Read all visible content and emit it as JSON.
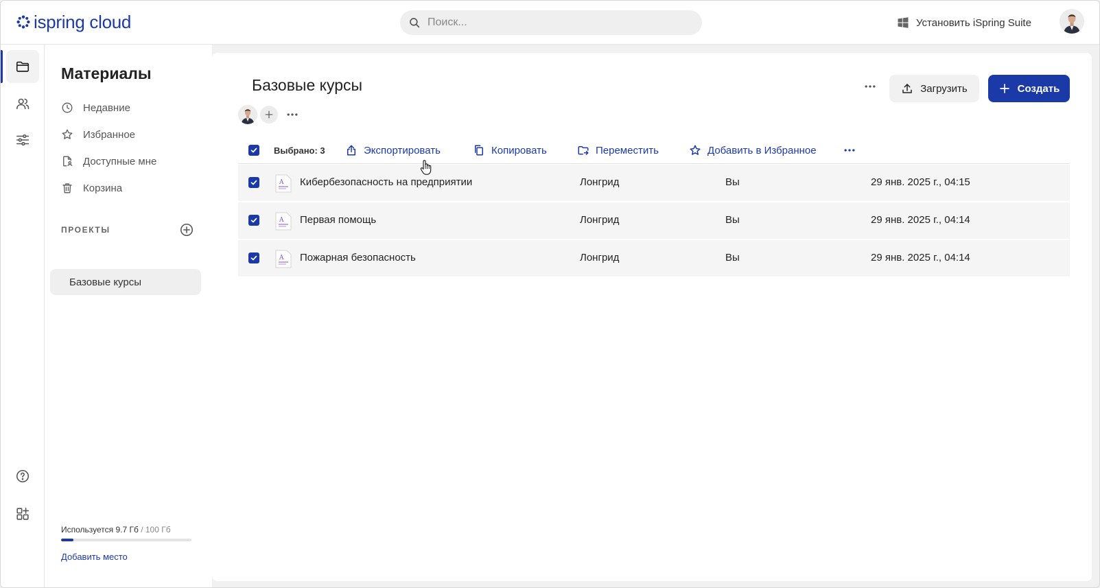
{
  "colors": {
    "accent": "#1b3aa8",
    "row_bg": "#f5f5f5",
    "panel_bg": "#f1f1f1"
  },
  "header": {
    "logo": {
      "word1": "ispring",
      "word2": " cloud"
    },
    "search": {
      "placeholder": "Поиск..."
    },
    "install_label": "Установить iSpring Suite"
  },
  "rail": {
    "items": [
      {
        "icon": "folder-icon",
        "active": true
      },
      {
        "icon": "users-icon",
        "active": false
      },
      {
        "icon": "sliders-icon",
        "active": false
      },
      {
        "icon": "help-icon",
        "active": false
      },
      {
        "icon": "apps-add-icon",
        "active": false
      }
    ]
  },
  "sidebar": {
    "title": "Материалы",
    "items": [
      {
        "label": "Недавние",
        "icon": "clock-icon"
      },
      {
        "label": "Избранное",
        "icon": "star-icon"
      },
      {
        "label": "Доступные мне",
        "icon": "shared-file-icon"
      },
      {
        "label": "Корзина",
        "icon": "trash-icon"
      }
    ],
    "projects_header": "ПРОЕКТЫ",
    "projects": [
      {
        "label": "Базовые курсы"
      }
    ],
    "storage": {
      "used_label": "Используется 9.7 Гб",
      "total_label": " / 100 Гб",
      "fraction": 0.097
    },
    "add_space_label": "Добавить место"
  },
  "main": {
    "title": "Базовые курсы",
    "upload_label": "Загрузить",
    "create_label": "Создать",
    "toolbar": {
      "selected_label": "Выбрано: 3",
      "actions": [
        {
          "label": "Экспортировать",
          "icon": "export-icon"
        },
        {
          "label": "Копировать",
          "icon": "copy-icon"
        },
        {
          "label": "Переместить",
          "icon": "move-folder-icon"
        },
        {
          "label": "Добавить в Избранное",
          "icon": "star-icon"
        }
      ]
    },
    "rows": [
      {
        "name": "Кибербезопасность на предприятии",
        "type": "Лонгрид",
        "owner": "Вы",
        "date": "29 янв. 2025 г., 04:15",
        "checked": true
      },
      {
        "name": "Первая помощь",
        "type": "Лонгрид",
        "owner": "Вы",
        "date": "29 янв. 2025 г., 04:14",
        "checked": true
      },
      {
        "name": "Пожарная безопасность",
        "type": "Лонгрид",
        "owner": "Вы",
        "date": "29 янв. 2025 г., 04:14",
        "checked": true
      }
    ]
  }
}
